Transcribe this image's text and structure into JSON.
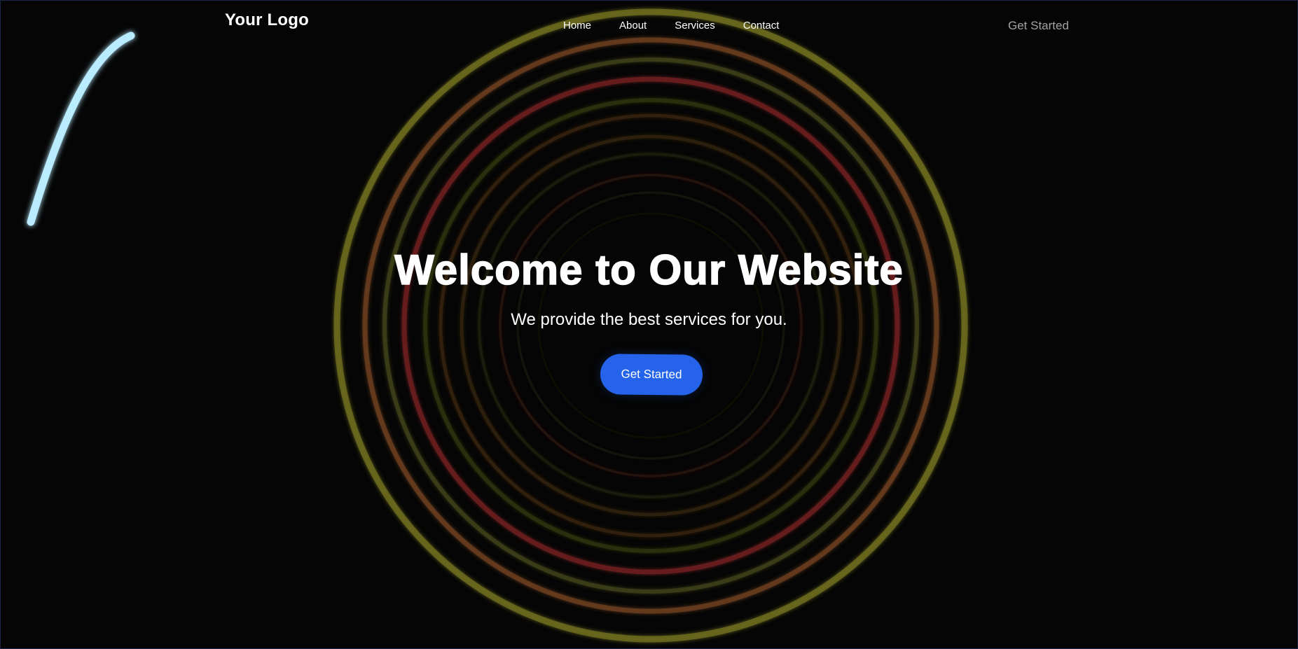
{
  "navbar": {
    "logo": "Your Logo",
    "links": [
      "Home",
      "About",
      "Services",
      "Contact"
    ],
    "cta_label": "Get Started"
  },
  "hero": {
    "title": "Welcome to Our Website",
    "subtitle": "We provide the best services for you.",
    "button_label": "Get Started"
  },
  "colors": {
    "background": "#050505",
    "primary_button": "#2563eb",
    "ring_yellow": "#6b6a1e",
    "ring_orange": "#6b3d1e",
    "ring_red": "#6e1f1f",
    "ring_olive": "#3c3f17",
    "comet": "#b9ecff"
  }
}
